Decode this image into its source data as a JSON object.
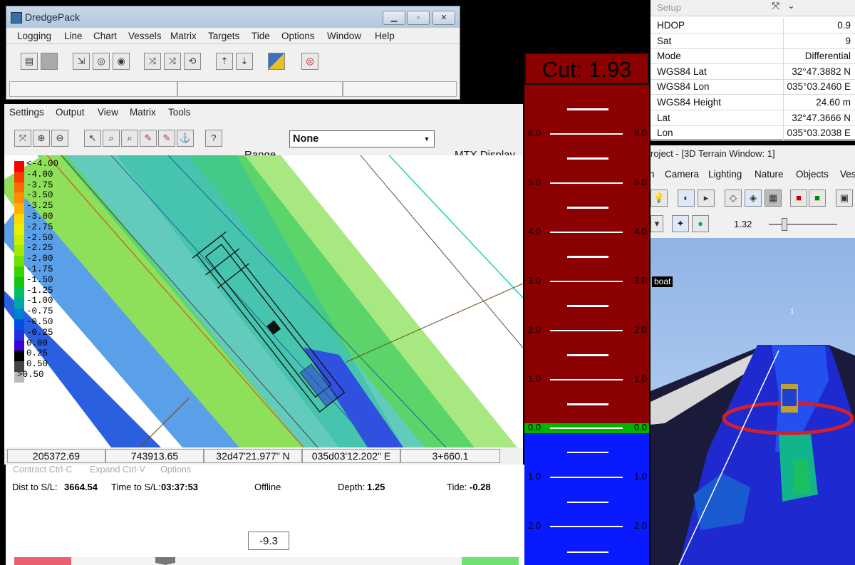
{
  "dredgepack": {
    "title": "DredgePack",
    "menu": [
      "Logging",
      "Line",
      "Chart",
      "Vessels",
      "Matrix",
      "Targets",
      "Tide",
      "Options",
      "Window",
      "Help"
    ],
    "toolbar_icons": [
      "logbook-icon",
      "blank-icon",
      "vessel-add-icon",
      "target-icon",
      "target-ring-icon",
      "swap-line-icon",
      "swap-line-2-icon",
      "refresh-icon",
      "tide-up-icon",
      "tide-down-icon",
      "pencil-chart-icon",
      "target-bullseye-icon"
    ]
  },
  "mtx": {
    "menu": [
      "Settings",
      "Output",
      "View",
      "Matrix",
      "Tools"
    ],
    "range_label": "Range",
    "range_value": "None",
    "display_label": "MTX Display",
    "legend": [
      "<-4.00",
      "-4.00",
      "-3.75",
      "-3.50",
      "-3.25",
      "-3.00",
      "-2.75",
      "-2.50",
      "-2.25",
      "-2.00",
      "-1.75",
      "-1.50",
      "-1.25",
      "-1.00",
      "-0.75",
      "-0.50",
      "-0.25",
      "0.00",
      "0.25",
      "0.50",
      ">0.50"
    ],
    "legend_colors": [
      "#ff0000",
      "#ff3a00",
      "#ff6a00",
      "#ff8c00",
      "#ffb000",
      "#ffd800",
      "#e8f000",
      "#c8f000",
      "#a0ec00",
      "#6fe000",
      "#38d400",
      "#10c810",
      "#00c060",
      "#00a8a0",
      "#0080d0",
      "#0050e0",
      "#2030e0",
      "#4000d0",
      "#000000",
      "#444444",
      "#bbbbbb"
    ],
    "coords": [
      "205372.69",
      "743913.65",
      "32d47'21.977\" N",
      "035d03'12.202\" E",
      "3+660.1"
    ]
  },
  "info": {
    "menu": [
      "Contract Ctrl-C",
      "Expand Ctrl-V",
      "Options"
    ],
    "dist_label": "Dist to S/L:",
    "dist_value": "3664.54",
    "time_label": "Time to S/L:",
    "time_value": "03:37:53",
    "status": "Offline",
    "depth_label": "Depth:",
    "depth_value": "1.25",
    "tide_label": "Tide:",
    "tide_value": "-0.28",
    "depth_box": "-9.3"
  },
  "cut": {
    "label": "Cut: 1.93",
    "ticks_red": [
      "6.0",
      "5.0",
      "4.0",
      "3.0",
      "2.0",
      "1.0"
    ],
    "tick_zero": "0.0",
    "ticks_blue": [
      "1.0",
      "2.0"
    ],
    "colors": {
      "above": "#8b0000",
      "below": "#0a1aff",
      "zero": "#00b400"
    }
  },
  "setup": {
    "title": "Setup",
    "rows": [
      {
        "key": "HDOP",
        "value": "0.9"
      },
      {
        "key": "Sat",
        "value": "9"
      },
      {
        "key": "Mode",
        "value": "Differential"
      },
      {
        "key": "WGS84 Lat",
        "value": "32°47.3882 N"
      },
      {
        "key": "WGS84 Lon",
        "value": "035°03.2460 E"
      },
      {
        "key": "WGS84 Height",
        "value": "24.60 m"
      },
      {
        "key": "Lat",
        "value": "32°47.3666 N"
      },
      {
        "key": "Lon",
        "value": "035°03.2038 E"
      }
    ]
  },
  "terrain": {
    "title": "roject - [3D Terrain Window: 1]",
    "menu": [
      "n",
      "Camera",
      "Lighting",
      "Nature",
      "Objects",
      "Ves"
    ],
    "zoom_value": "1.32",
    "boat_label": "boat",
    "marker_label": "1"
  }
}
